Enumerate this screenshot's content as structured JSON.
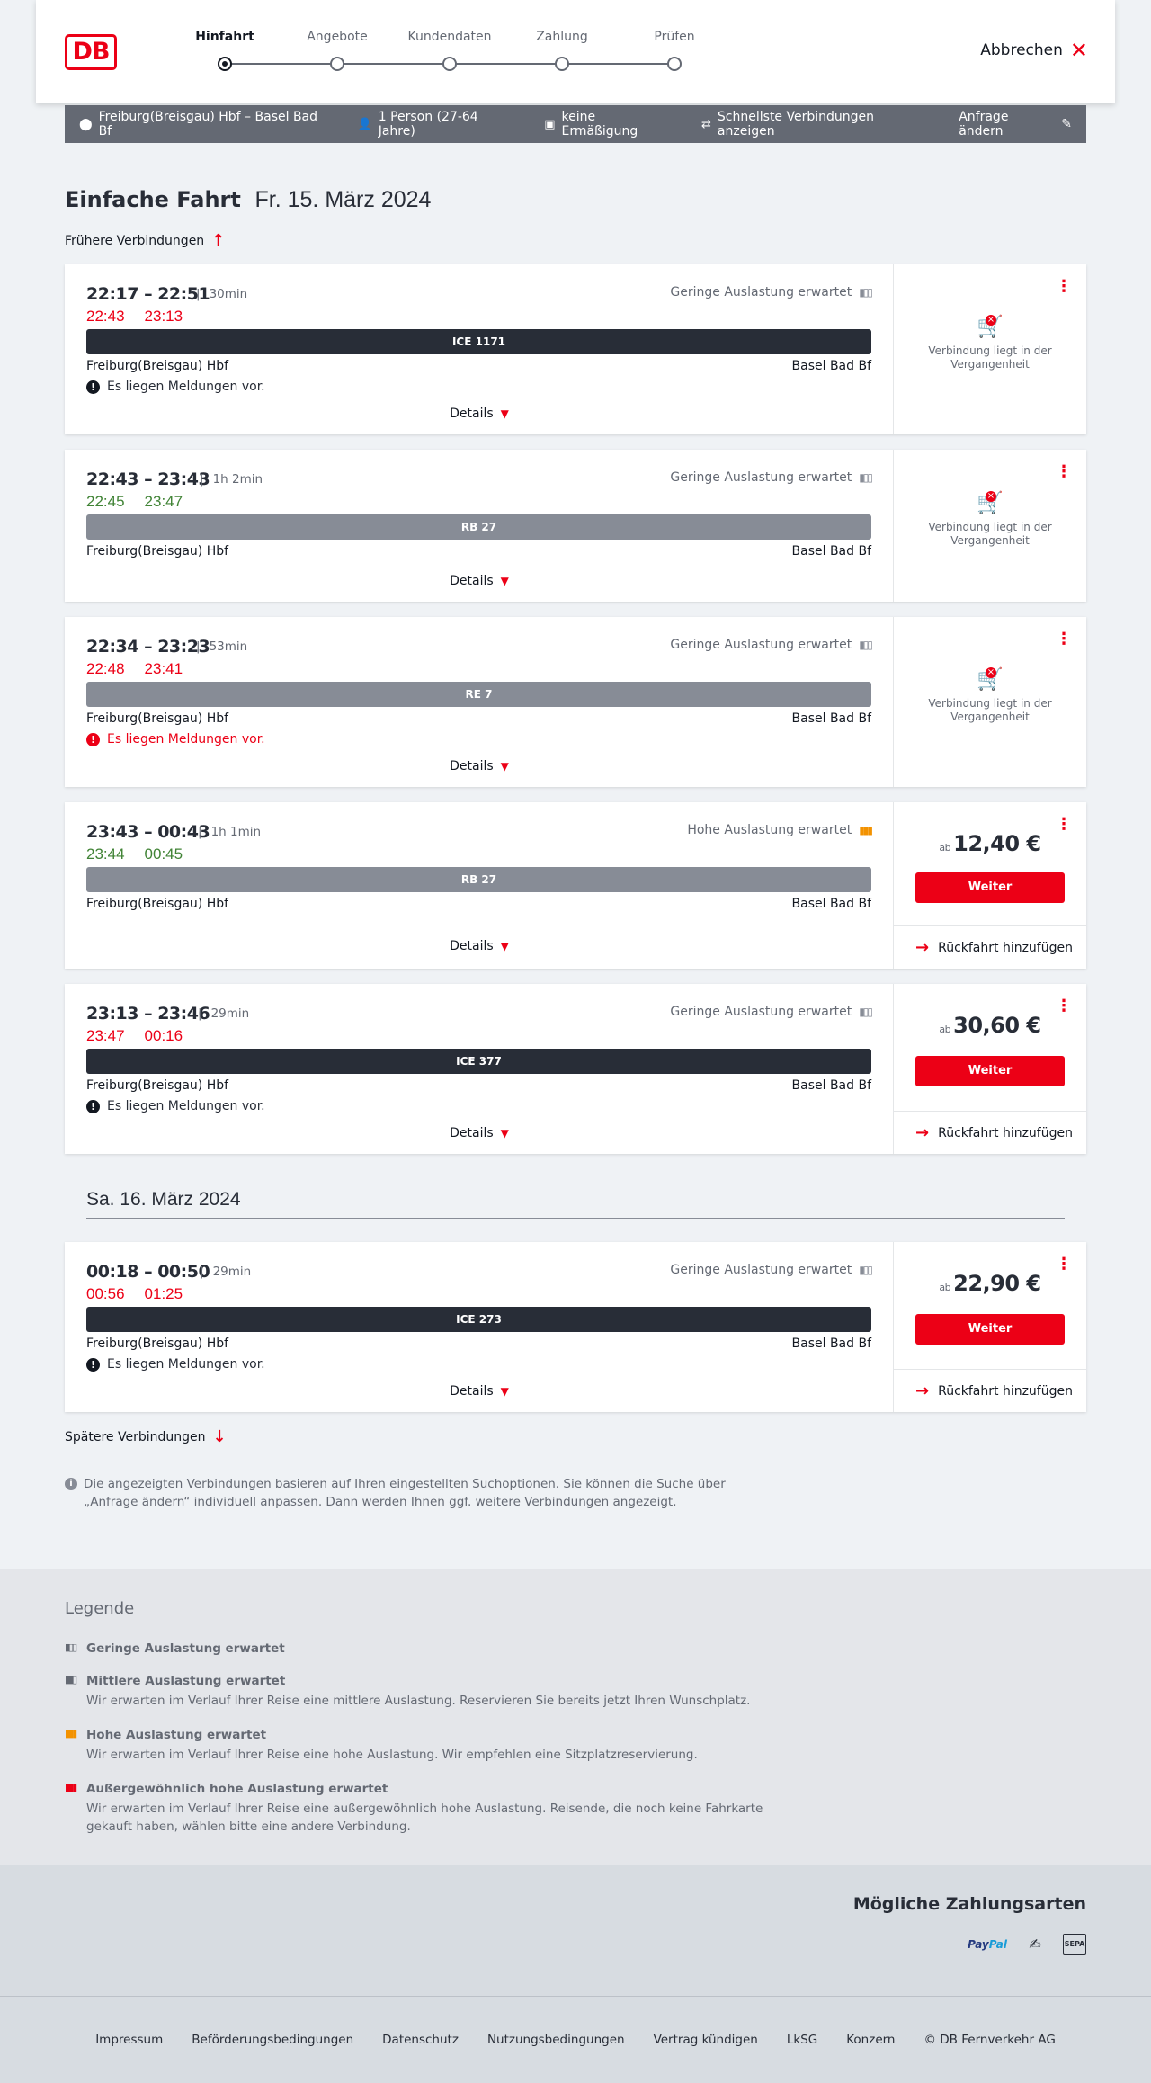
{
  "header": {
    "logo": "DB",
    "steps": [
      {
        "label": "Hinfahrt",
        "active": true
      },
      {
        "label": "Angebote",
        "active": false
      },
      {
        "label": "Kundendaten",
        "active": false
      },
      {
        "label": "Zahlung",
        "active": false
      },
      {
        "label": "Prüfen",
        "active": false
      }
    ],
    "cancel_label": "Abbrechen"
  },
  "search_summary": {
    "route": "Freiburg(Breisgau) Hbf – Basel Bad Bf",
    "travellers": "1 Person (27-64 Jahre)",
    "discount": "keine Ermäßigung",
    "option": "Schnellste Verbindungen anzeigen",
    "edit_label": "Anfrage ändern"
  },
  "page": {
    "title": "Einfache Fahrt",
    "date": "Fr. 15. März 2024",
    "earlier_label": "Frühere Verbindungen",
    "later_label": "Spätere Verbindungen",
    "next_day": "Sa. 16. März 2024",
    "details_label": "Details",
    "past_label_1": "Verbindung liegt in der",
    "past_label_2": "Vergangenheit",
    "weiter_label": "Weiter",
    "return_label": "Rückfahrt hinzufügen",
    "price_prefix": "ab",
    "info_text": "Die angezeigten Verbindungen basieren auf Ihren eingestellten Suchoptionen. Sie können die Suche über „Anfrage ändern“ individuell anpassen. Dann werden Ihnen ggf. weitere Verbindungen angezeigt."
  },
  "connections": [
    {
      "times": "22:17 – 22:51",
      "duration": "30min",
      "rt_dep": "22:43",
      "rt_arr": "23:13",
      "rt_status": "late",
      "load": "Geringe Auslastung erwartet",
      "load_level": "low",
      "train": "ICE 1171",
      "train_style": "dark",
      "from": "Freiburg(Breisgau) Hbf",
      "to": "Basel Bad Bf",
      "message": "Es liegen Meldungen vor.",
      "message_style": "normal",
      "past": true
    },
    {
      "times": "22:43 – 23:43",
      "duration": "1h 2min",
      "rt_dep": "22:45",
      "rt_arr": "23:47",
      "rt_status": "ok",
      "load": "Geringe Auslastung erwartet",
      "load_level": "low",
      "train": "RB 27",
      "train_style": "grey",
      "from": "Freiburg(Breisgau) Hbf",
      "to": "Basel Bad Bf",
      "message": "",
      "past": true
    },
    {
      "times": "22:34 – 23:23",
      "duration": "53min",
      "rt_dep": "22:48",
      "rt_arr": "23:41",
      "rt_status": "late",
      "load": "Geringe Auslastung erwartet",
      "load_level": "low",
      "train": "RE 7",
      "train_style": "grey",
      "from": "Freiburg(Breisgau) Hbf",
      "to": "Basel Bad Bf",
      "message": "Es liegen Meldungen vor.",
      "message_style": "red",
      "past": true
    },
    {
      "times": "23:43 – 00:43",
      "duration": "1h 1min",
      "rt_dep": "23:44",
      "rt_arr": "00:45",
      "rt_status": "ok",
      "load": "Hohe Auslastung erwartet",
      "load_level": "high",
      "train": "RB 27",
      "train_style": "grey",
      "from": "Freiburg(Breisgau) Hbf",
      "to": "Basel Bad Bf",
      "message": "",
      "past": false,
      "price": "12,40 €"
    },
    {
      "times": "23:13 – 23:46",
      "duration": "29min",
      "rt_dep": "23:47",
      "rt_arr": "00:16",
      "rt_status": "late",
      "load": "Geringe Auslastung erwartet",
      "load_level": "low",
      "train": "ICE 377",
      "train_style": "dark",
      "from": "Freiburg(Breisgau) Hbf",
      "to": "Basel Bad Bf",
      "message": "Es liegen Meldungen vor.",
      "message_style": "normal",
      "past": false,
      "price": "30,60 €"
    },
    {
      "times": "00:18 – 00:50",
      "duration": "29min",
      "rt_dep": "00:56",
      "rt_arr": "01:25",
      "rt_status": "late",
      "load": "Geringe Auslastung erwartet",
      "load_level": "low",
      "train": "ICE 273",
      "train_style": "dark",
      "from": "Freiburg(Breisgau) Hbf",
      "to": "Basel Bad Bf",
      "message": "Es liegen Meldungen vor.",
      "message_style": "normal",
      "past": false,
      "price": "22,90 €"
    }
  ],
  "legend": {
    "title": "Legende",
    "items": [
      {
        "title": "Geringe Auslastung erwartet",
        "text": ""
      },
      {
        "title": "Mittlere Auslastung erwartet",
        "text": "Wir erwarten im Verlauf Ihrer Reise eine mittlere Auslastung. Reservieren Sie bereits jetzt Ihren Wunschplatz."
      },
      {
        "title": "Hohe Auslastung erwartet",
        "text": "Wir erwarten im Verlauf Ihrer Reise eine hohe Auslastung. Wir empfehlen eine Sitzplatzreservierung."
      },
      {
        "title": "Außergewöhnlich hohe Auslastung erwartet",
        "text": "Wir erwarten im Verlauf Ihrer Reise eine außergewöhnlich hohe Auslastung. Reisende, die noch keine Fahrkarte gekauft haben, wählen bitte eine andere Verbindung."
      }
    ]
  },
  "payments": {
    "title": "Mögliche Zahlungsarten",
    "paypal_a": "Pay",
    "paypal_b": "Pal",
    "sepa": "SEPA"
  },
  "footer": {
    "links": [
      "Impressum",
      "Beförderungsbedingungen",
      "Datenschutz",
      "Nutzungsbedingungen",
      "Vertrag kündigen",
      "LkSG",
      "Konzern",
      "© DB Fernverkehr AG"
    ]
  },
  "colors": {
    "accent": "#ec0016",
    "late": "#ec0016",
    "on_time": "#408335",
    "high_load": "#f39200"
  }
}
